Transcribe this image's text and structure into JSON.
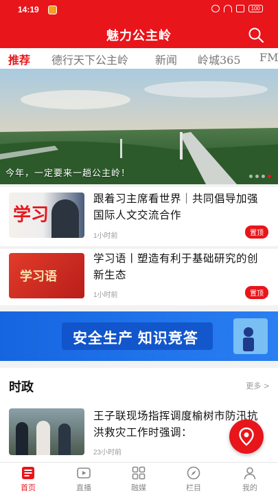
{
  "status": {
    "time": "14:19",
    "battery": "100"
  },
  "header": {
    "title": "魅力公主岭"
  },
  "tabs": [
    {
      "label": "推荐",
      "active": true
    },
    {
      "label": "德行天下公主岭"
    },
    {
      "label": "新闻"
    },
    {
      "label": "岭城365"
    },
    {
      "label": "FM"
    }
  ],
  "banner": {
    "caption": "今年，一定要来一趟公主岭！",
    "slides": 4,
    "current": 3
  },
  "news": [
    {
      "title": "跟着习主席看世界｜共同倡导加强国际人文交流合作",
      "time": "1小时前",
      "badge": "置顶",
      "thumb_text": "学习"
    },
    {
      "title": "学习语丨塑造有利于基础研究的创新生态",
      "time": "1小时前",
      "badge": "置顶",
      "thumb_text": "学习语"
    },
    {
      "title": "王子联现场指挥调度榆树市防汛抗洪救灾工作时强调：",
      "time": "23小时前"
    }
  ],
  "ad": {
    "text": "安全生产 知识竞答"
  },
  "section": {
    "title": "时政",
    "more": "更多 >"
  },
  "nav": [
    {
      "label": "首页",
      "icon": "news-icon",
      "active": true
    },
    {
      "label": "直播",
      "icon": "live-tv-icon"
    },
    {
      "label": "融媒",
      "icon": "grid-icon"
    },
    {
      "label": "栏目",
      "icon": "compass-icon"
    },
    {
      "label": "我的",
      "icon": "user-icon"
    }
  ],
  "colors": {
    "brand": "#e8151b"
  }
}
